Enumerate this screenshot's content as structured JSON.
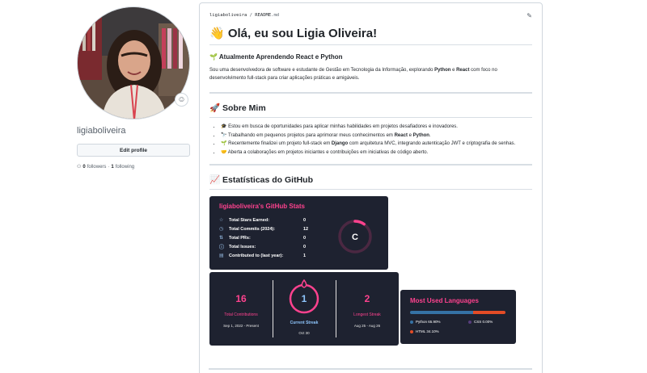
{
  "profile": {
    "username": "ligiaboliveira",
    "edit_label": "Edit profile",
    "followers_count": "0",
    "followers_label": "followers",
    "following_count": "1",
    "following_label": "following",
    "separator": "·"
  },
  "readme": {
    "path_user": "ligiaboliveira",
    "path_sep": "/",
    "path_file": "README",
    "path_ext": ".md",
    "title": "👋 Olá, eu sou Ligia Oliveira!",
    "learning_heading": "🌱 Atualmente Aprendendo React e Python",
    "intro_1": "Sou uma desenvolvedora de software e estudante de Gestão em Tecnologia da Informação, explorando ",
    "intro_python": "Python",
    "intro_and": " e ",
    "intro_react": "React",
    "intro_2": " com foco no desenvolvimento full-stack para criar aplicações práticas e amigáveis.",
    "about_heading": "🚀 Sobre Mim",
    "about_items": [
      {
        "text": "🎓 Estou em busca de oportunidades para aplicar minhas habilidades em projetos desafiadores e inovadores."
      },
      {
        "pre": "🔭 Trabalhando em pequenos projetos para aprimorar meus conhecimentos em ",
        "b1": "React",
        "mid": " e ",
        "b2": "Python",
        "post": "."
      },
      {
        "pre": "🌱 Recentemente finalizei um projeto full-stack em ",
        "b1": "Django",
        "post": " com arquitetura MVC, integrando autenticação JWT e criptografia de senhas."
      },
      {
        "text": "🤝 Aberta a colaborações em projetos iniciantes e contribuições em iniciativas de código aberto."
      }
    ],
    "stats_heading": "📈 Estatísticas do GitHub"
  },
  "stats_card": {
    "title": "ligiaboliveira's GitHub Stats",
    "rows": [
      {
        "icon": "star-icon",
        "glyph": "☆",
        "label": "Total Stars Earned:",
        "value": "0"
      },
      {
        "icon": "clock-icon",
        "glyph": "◷",
        "label": "Total Commits (2024):",
        "value": "12"
      },
      {
        "icon": "pull-request-icon",
        "glyph": "⇅",
        "label": "Total PRs:",
        "value": "0"
      },
      {
        "icon": "issue-icon",
        "glyph": "ⓘ",
        "label": "Total Issues:",
        "value": "0"
      },
      {
        "icon": "repo-icon",
        "glyph": "▤",
        "label": "Contributed to (last year):",
        "value": "1"
      }
    ],
    "rank": "C",
    "rank_progress": 0.1,
    "colors": {
      "bg": "#1e2230",
      "title": "#fe428e",
      "icon": "#8fb3d9",
      "ring": "#fe428e"
    }
  },
  "streak_card": {
    "total": "16",
    "total_label": "Total Contributions",
    "total_range": "Sep 1, 2022 - Present",
    "current": "1",
    "current_label": "Current Streak",
    "current_date": "Oct 30",
    "longest": "2",
    "longest_label": "Longest Streak",
    "longest_range": "Aug 25 - Aug 26",
    "colors": {
      "number": "#fe428e",
      "current_number": "#8ec5fc",
      "label_side": "#fe428e",
      "label_current": "#8ec5fc"
    }
  },
  "languages_card": {
    "title": "Most Used Languages",
    "languages": [
      {
        "name": "Python",
        "percent": 65.9,
        "label": "Python 65.90%",
        "color": "#3572A5"
      },
      {
        "name": "CSS",
        "percent": 0.0,
        "label": "CSS 0.00%",
        "color": "#563d7c"
      },
      {
        "name": "HTML",
        "percent": 34.1,
        "label": "HTML 34.10%",
        "color": "#e34c26"
      }
    ]
  }
}
